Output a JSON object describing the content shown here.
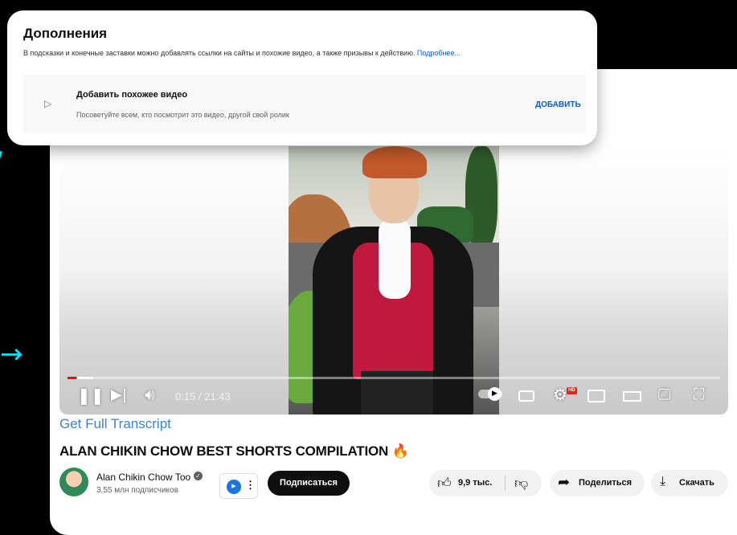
{
  "extras": {
    "title": "Дополнения",
    "description": "В подсказки и конечные заставки можно добавлять ссылки на сайты и похожие видео, а также призывы к действию.",
    "more_link": "Подробнее...",
    "item": {
      "title": "Добавить похожее видео",
      "description": "Посоветуйте всем, кто посмотрит это видео, другой свой ролик",
      "action": "ДОБАВИТЬ"
    }
  },
  "player": {
    "time": "0:15 / 21:43",
    "hd_badge": "HD",
    "progress_played": 0.014,
    "progress_buffered": 0.04
  },
  "below": {
    "transcript_link": "Get Full Transcript",
    "video_title": "ALAN CHIKIN CHOW BEST SHORTS COMPILATION 🔥",
    "channel_name": "Alan Chikin Chow Too",
    "subscribers": "3,55 млн подписчиков",
    "subscribe_label": "Подписаться",
    "like_count": "9,9 тыс.",
    "share_label": "Поделиться",
    "download_label": "Скачать"
  },
  "colors": {
    "accent_cyan": "#00e5ff",
    "progress_red": "#ff0000",
    "link_blue": "#065fd4"
  },
  "icons": [
    "pause-icon",
    "next-icon",
    "volume-icon",
    "autoplay-toggle",
    "subtitles-icon",
    "settings-icon",
    "miniplayer-icon",
    "theater-icon",
    "cast-icon",
    "fullscreen-icon",
    "thumb-up-icon",
    "thumb-down-icon",
    "share-icon",
    "download-icon",
    "verified-icon"
  ]
}
